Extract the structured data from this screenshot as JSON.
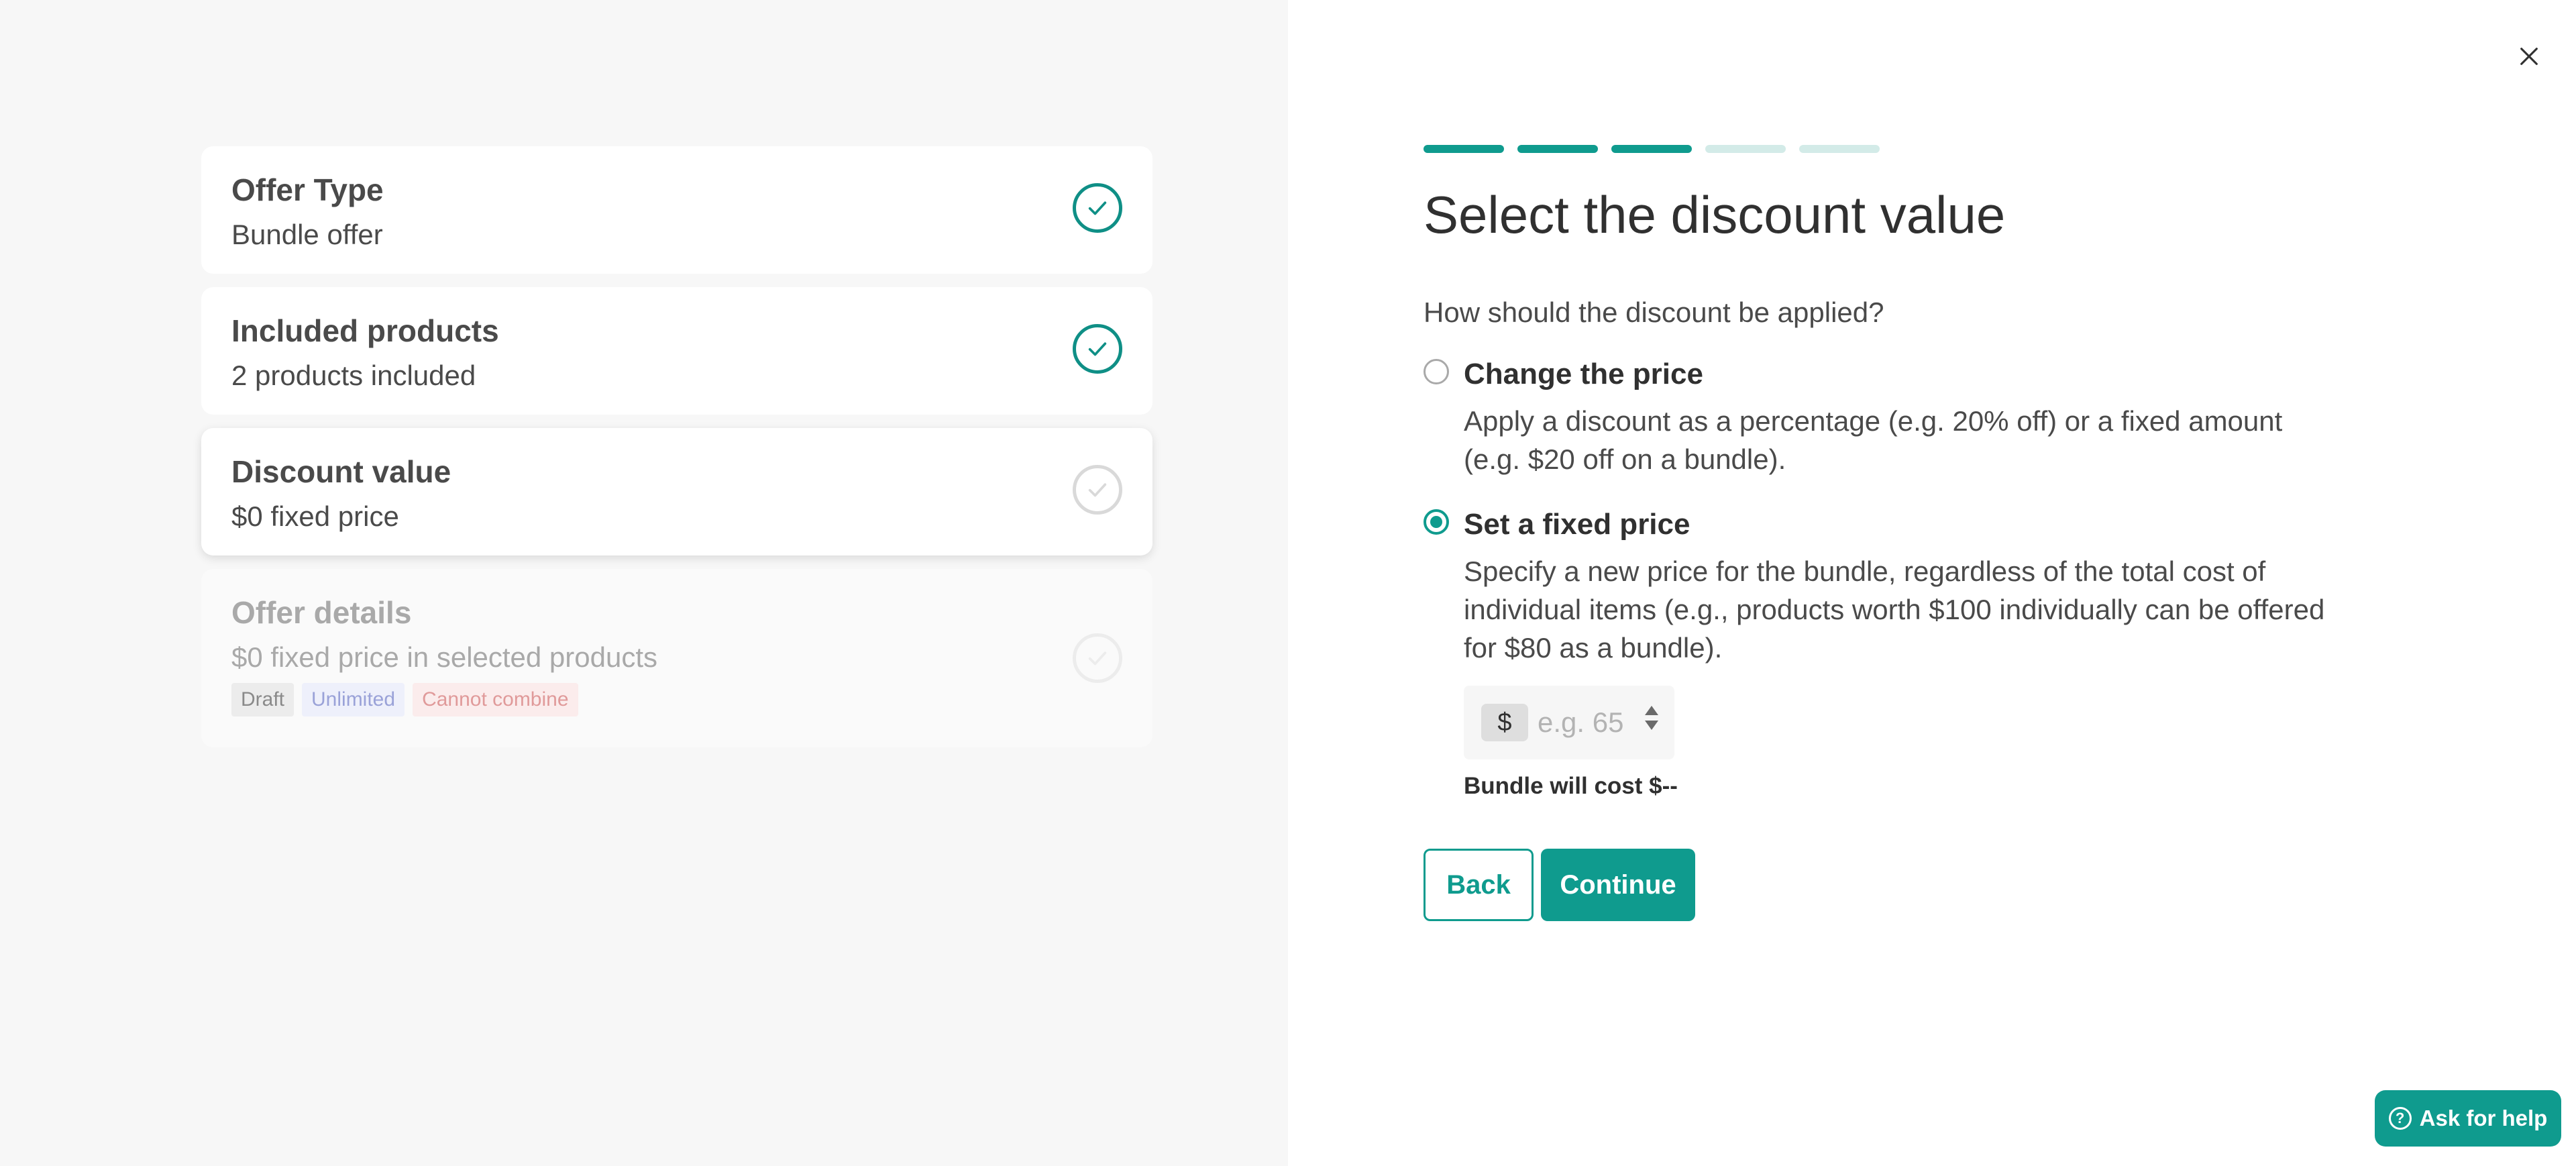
{
  "summary": {
    "cards": [
      {
        "title": "Offer Type",
        "subtitle": "Bundle offer",
        "state": "complete"
      },
      {
        "title": "Included products",
        "subtitle": "2 products included",
        "state": "complete"
      },
      {
        "title": "Discount value",
        "subtitle": "$0 fixed price",
        "state": "active"
      },
      {
        "title": "Offer details",
        "subtitle": "$0 fixed price in selected products",
        "state": "upcoming",
        "badges": [
          "Draft",
          "Unlimited",
          "Cannot combine"
        ]
      }
    ]
  },
  "wizard": {
    "progress": {
      "completed_steps": 3,
      "total_steps": 5
    },
    "heading": "Select the discount value",
    "question": "How should the discount be applied?",
    "options": [
      {
        "title": "Change the price",
        "description": "Apply a discount as a percentage (e.g. 20% off) or a fixed amount (e.g. $20 off on a bundle).",
        "selected": false
      },
      {
        "title": "Set a fixed price",
        "description": "Specify a new price for the bundle, regardless of the total cost of individual items (e.g., products worth $100 individually can be offered for $80 as a bundle).",
        "selected": true
      }
    ],
    "price_input": {
      "prefix": "$",
      "placeholder": "e.g. 65",
      "value": ""
    },
    "cost_text": "Bundle will cost $--",
    "back_label": "Back",
    "continue_label": "Continue"
  },
  "help": {
    "label": "Ask for help",
    "icon": "?"
  },
  "colors": {
    "accent": "#0f9b8e",
    "accent_light": "#d3ebe8",
    "left_bg": "#f7f7f7"
  }
}
